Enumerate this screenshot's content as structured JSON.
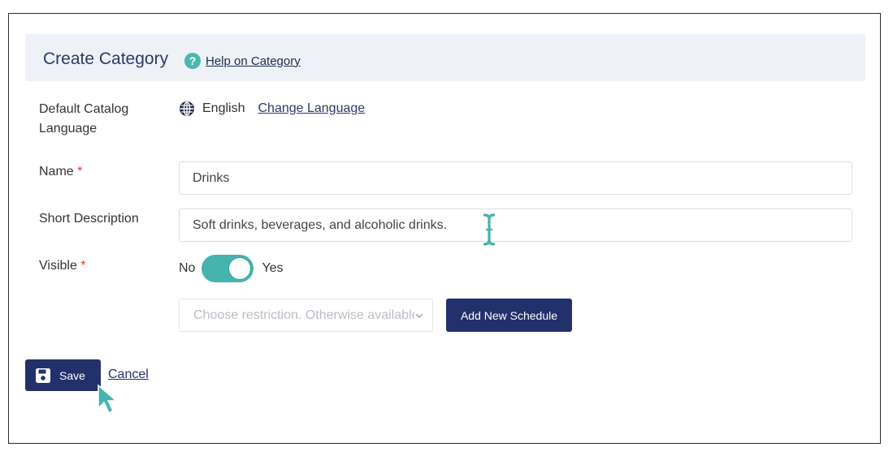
{
  "header": {
    "title": "Create Category",
    "help_icon": "question-circle-icon",
    "help_link": "Help on Category"
  },
  "form": {
    "language": {
      "label": "Default Catalog Language",
      "icon": "globe-icon",
      "value": "English",
      "change_link": "Change Language"
    },
    "name": {
      "label": "Name",
      "required_mark": "*",
      "value": "Drinks"
    },
    "short_description": {
      "label": "Short Description",
      "value": "Soft drinks, beverages, and alcoholic drinks."
    },
    "visible": {
      "label": "Visible",
      "required_mark": "*",
      "off_label": "No",
      "on_label": "Yes",
      "state": "on"
    },
    "restriction": {
      "placeholder": "Choose restriction. Otherwise available"
    },
    "add_schedule_label": "Add New Schedule"
  },
  "actions": {
    "save_label": "Save",
    "cancel_label": "Cancel"
  },
  "colors": {
    "primary": "#22316b",
    "accent": "#46b3ad",
    "header_bg": "#eef2f6",
    "required": "#e53935"
  }
}
